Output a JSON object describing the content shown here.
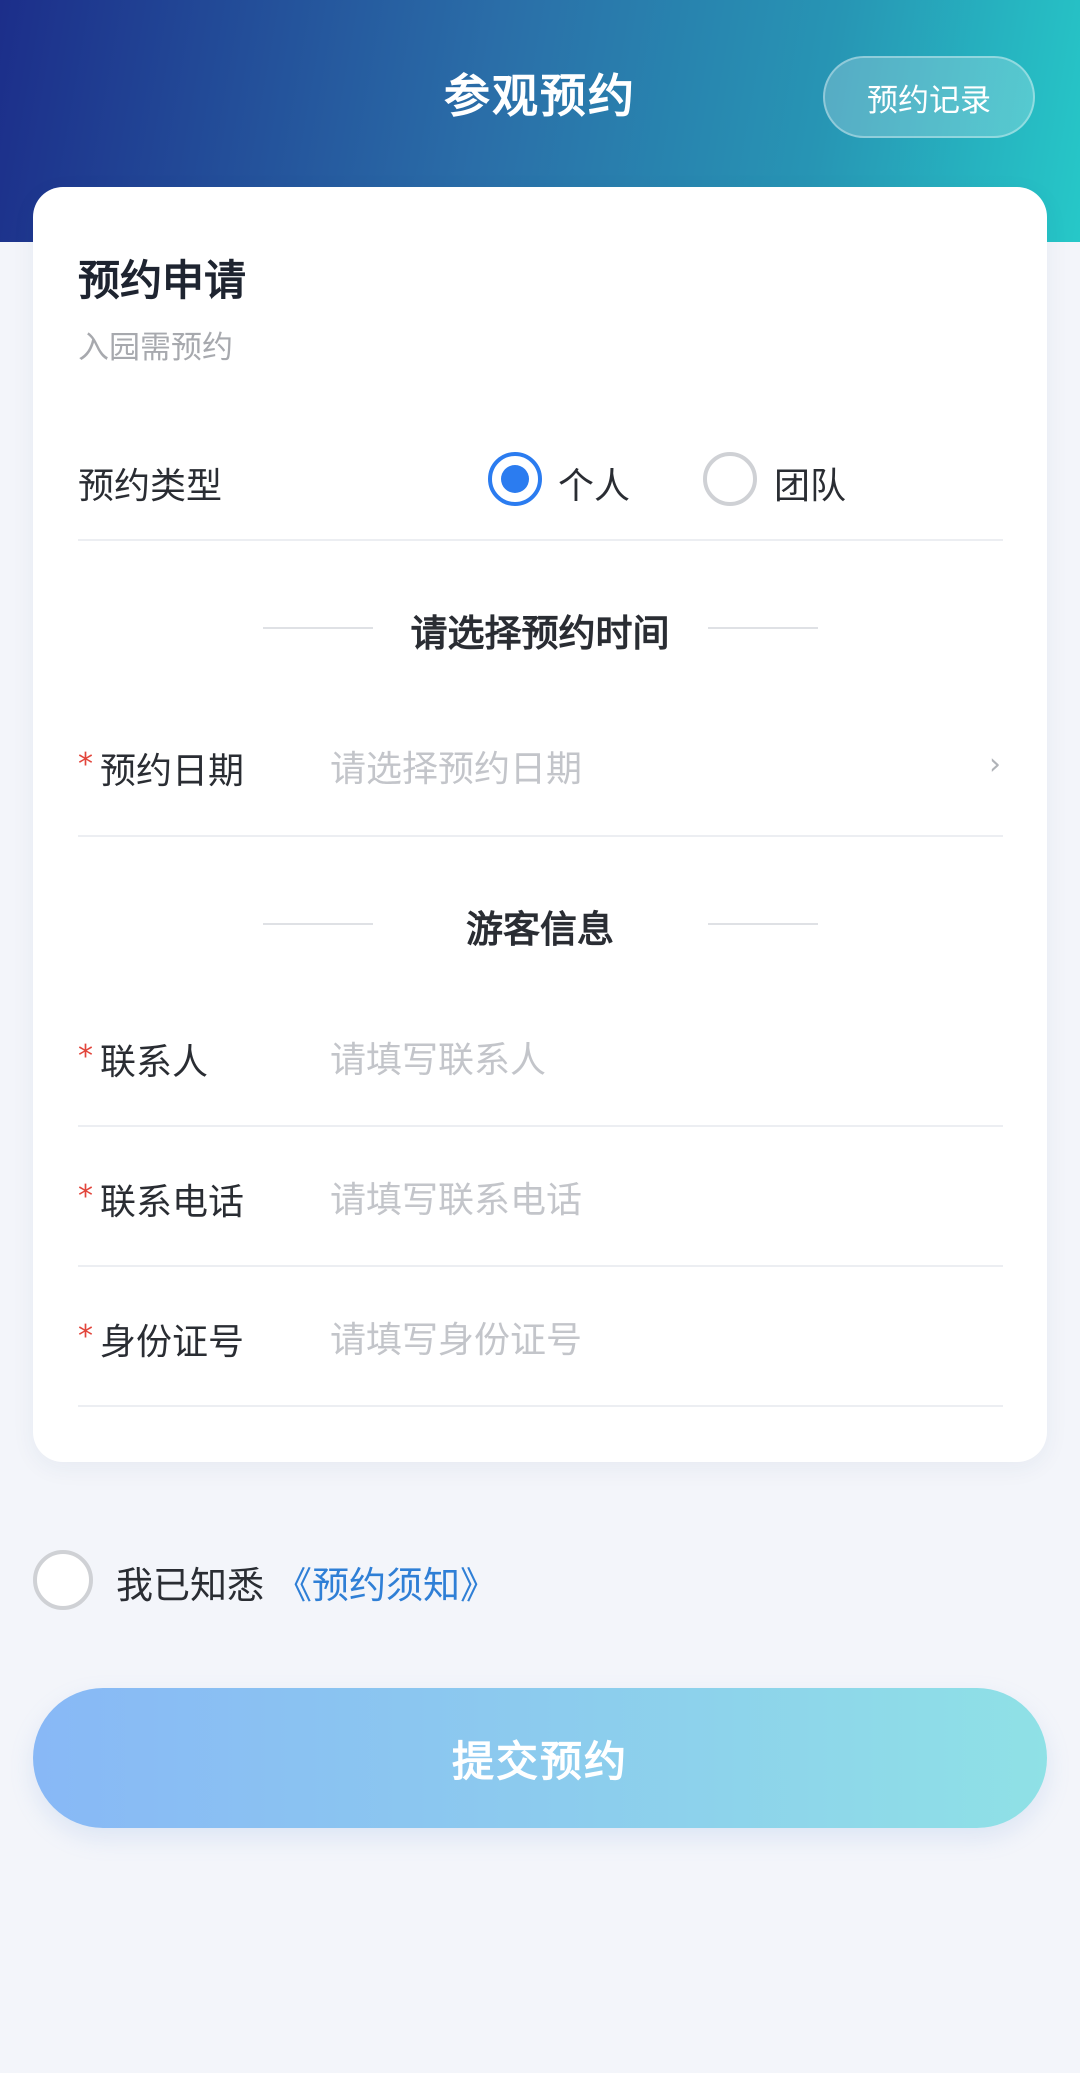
{
  "header": {
    "title": "参观预约",
    "records_label": "预约记录"
  },
  "card": {
    "title": "预约申请",
    "subtitle": "入园需预约",
    "type_row": {
      "label": "预约类型",
      "options": [
        "个人",
        "团队"
      ],
      "selected": "个人"
    },
    "time_section": "请选择预约时间",
    "date_row": {
      "required": "*",
      "label": "预约日期",
      "placeholder": "请选择预约日期",
      "chevron": "›"
    },
    "visitor_section": "游客信息",
    "contact_row": {
      "required": "*",
      "label": "联系人",
      "placeholder": "请填写联系人"
    },
    "phone_row": {
      "required": "*",
      "label": "联系电话",
      "placeholder": "请填写联系电话"
    },
    "id_row": {
      "required": "*",
      "label": "身份证号",
      "placeholder": "请填写身份证号"
    }
  },
  "agreement": {
    "text": "我已知悉",
    "link": "《预约须知》"
  },
  "submit_label": "提交预约"
}
